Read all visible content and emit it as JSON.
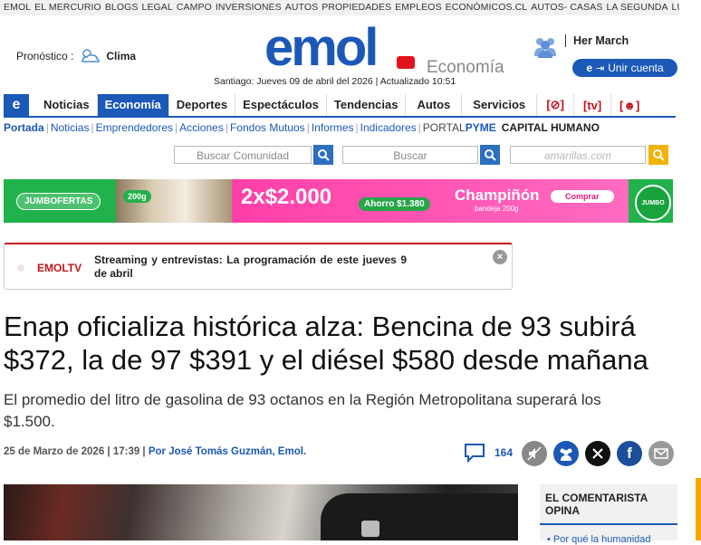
{
  "top_links": [
    "EMOL",
    "EL MERCURIO",
    "BLOGS",
    "LEGAL",
    "CAMPO",
    "INVERSIONES",
    "AUTOS",
    "PROPIEDADES",
    "EMPLEOS",
    "ECONÓMICOS.CL",
    "AUTOS- CASAS",
    "LA SEGUNDA",
    "LUN"
  ],
  "header": {
    "forecast_label": "Pronóstico :",
    "clima": "Clima",
    "logo_text": "emol",
    "section": "Economía",
    "dateline": "Santiago: Jueves 09 de abril del 2026 | Actualizado 10:51",
    "username": "Her March",
    "join_label": "Unir cuenta"
  },
  "nav": {
    "items": [
      "Noticias",
      "Economía",
      "Deportes",
      "Espectáculos",
      "Tendencias",
      "Autos",
      "Servicios"
    ],
    "active": "Economía"
  },
  "subnav": {
    "links": [
      "Portada",
      "Noticias",
      "Emprendedores",
      "Acciones",
      "Fondos Mutuos",
      "Informes",
      "Indicadores"
    ],
    "portal": "PORTAL",
    "pyme": "PYME",
    "capital": "CAPITAL HUMANO"
  },
  "search": {
    "community_placeholder": "Buscar Comunidad",
    "main_placeholder": "Buscar",
    "amarillas_placeholder": "amarillas.com"
  },
  "banner": {
    "tag": "JUMBOFERTAS",
    "weight": "200g",
    "promo": "2x$2.000",
    "ahorro": "Ahorro $1.380",
    "product": "Champiñón",
    "package": "bandeja 200g",
    "cta": "Comprar",
    "brand": "JUMBO"
  },
  "alert": {
    "label": "EMOLTV",
    "text": "Streaming y entrevistas: La programación de este jueves 9 de abril"
  },
  "article": {
    "headline": "Enap oficializa histórica alza: Bencina de 93 subirá $372, la de 97 $391 y el diésel $580 desde mañana",
    "lead": "El promedio del litro de gasolina de 93 octanos en la Región Metropolitana superará los $1.500.",
    "date": "25 de Marzo de 2026 | 17:39 |",
    "author": "Por José Tomás Guzmán, Emol.",
    "comment_count": "164"
  },
  "sidebar": {
    "title": "EL COMENTARISTA OPINA",
    "teaser": "• Por qué la humanidad"
  },
  "colors": {
    "brand_blue": "#1b58b8",
    "brand_red": "#e1131d",
    "jumbo_green": "#21b24b"
  }
}
